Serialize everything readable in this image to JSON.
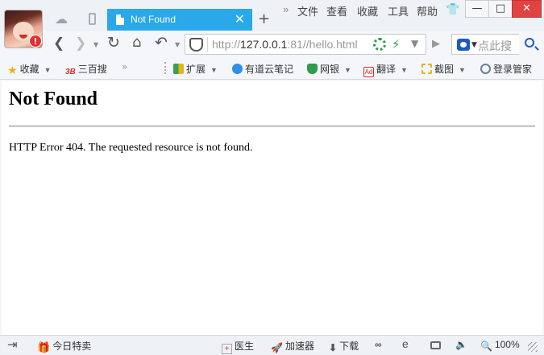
{
  "tabbar": {
    "active_tab_title": "Not Found",
    "close_glyph": "✕",
    "new_tab_glyph": "+",
    "menu": [
      "»",
      "文件",
      "查看",
      "收藏",
      "工具",
      "帮助"
    ],
    "window_buttons": {
      "minimize": "—",
      "maximize": "□",
      "close": "✕"
    },
    "avatar_badge": "!"
  },
  "navbar": {
    "url_scheme": "http://",
    "url_host": "127.0.0.1",
    "url_rest": ":81//hello.html",
    "search_placeholder": "点此搜"
  },
  "bookmarks": [
    {
      "label": "收藏",
      "icon": "star-icon",
      "color": "#e8b21b",
      "dropdown": true
    },
    {
      "label": "三百搜",
      "icon": "sanbaisou-icon",
      "color": "#d6322d",
      "dropdown": false
    },
    {
      "label": "扩展",
      "icon": "extension-icon",
      "color": "#3aa14f",
      "dropdown": true
    },
    {
      "label": "有道云笔记",
      "icon": "youdao-note-icon",
      "color": "#2f8fe3",
      "dropdown": false
    },
    {
      "label": "网银",
      "icon": "bank-shield-icon",
      "color": "#2e9c4e",
      "dropdown": true
    },
    {
      "label": "翻译",
      "icon": "translate-icon",
      "color": "#d6322d",
      "dropdown": true
    },
    {
      "label": "截图",
      "icon": "screenshot-icon",
      "color": "#e8b21b",
      "dropdown": true
    },
    {
      "label": "登录管家",
      "icon": "login-manager-icon",
      "color": "#6b7f99",
      "dropdown": false
    }
  ],
  "page": {
    "title": "Not Found",
    "message": "HTTP Error 404. The requested resource is not found."
  },
  "statusbar": {
    "today_deals": "今日特卖",
    "doctor": "医生",
    "accelerator": "加速器",
    "download": "下载",
    "zoom": "100%"
  }
}
